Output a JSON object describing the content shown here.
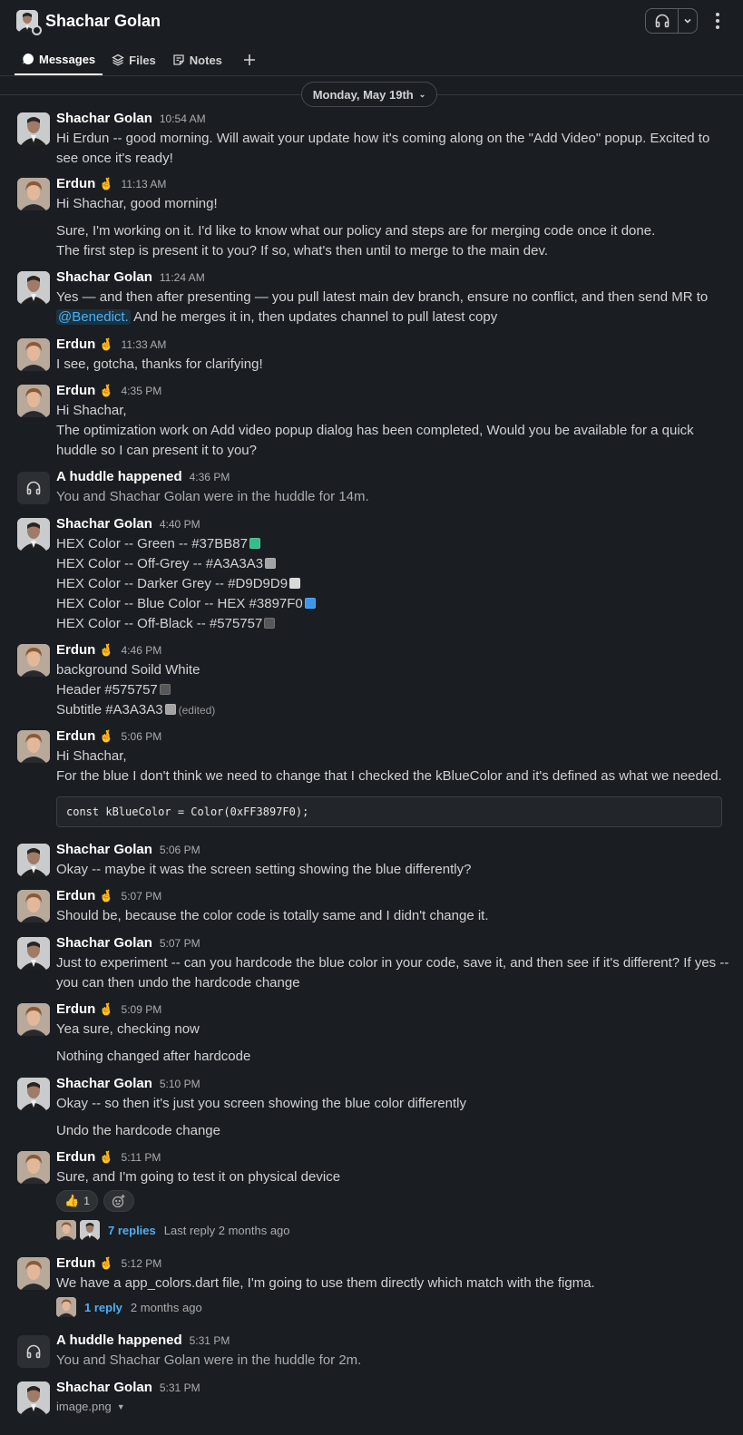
{
  "header": {
    "title": "Shachar Golan",
    "tabs": [
      {
        "label": "Messages",
        "icon": "message-bubble-icon",
        "active": true
      },
      {
        "label": "Files",
        "icon": "files-stack-icon",
        "active": false
      },
      {
        "label": "Notes",
        "icon": "notes-icon",
        "active": false
      }
    ]
  },
  "date_divider": "Monday, May 19th",
  "colors": {
    "background": "#1a1d21",
    "text": "#d1d2d3",
    "link": "#4faef2",
    "green": "#37BB87",
    "off_grey": "#A3A3A3",
    "darker_grey": "#D9D9D9",
    "blue": "#3897F0",
    "off_black": "#575757"
  },
  "messages": [
    {
      "author": "Shachar Golan",
      "time": "10:54 AM",
      "lines": [
        "Hi Erdun -- good morning. Will await your update how it's coming along on the \"Add Video\" popup. Excited to",
        "see once it's ready!"
      ]
    },
    {
      "author": "Erdun",
      "emoji": "🤞",
      "time": "11:13 AM",
      "lines": [
        "Hi Shachar, good morning!",
        "Sure, I'm working on it. I'd like to know what our policy and steps are for merging code once it done.",
        "The first step is present it to you?  If so, what's then until to merge to the main dev."
      ]
    },
    {
      "author": "Shachar Golan",
      "time": "11:24 AM",
      "lines": [
        "Yes — and then after presenting — you pull latest main dev branch, ensure no conflict, and then send MR to"
      ],
      "mention": "@Benedict.",
      "after_mention": " And he merges it in, then updates channel to pull latest copy"
    },
    {
      "author": "Erdun",
      "emoji": "🤞",
      "time": "11:33 AM",
      "lines": [
        "I see, gotcha, thanks for clarifying!"
      ]
    },
    {
      "author": "Erdun",
      "emoji": "🤞",
      "time": "4:35 PM",
      "lines": [
        "Hi Shachar,",
        "The optimization work on Add video popup dialog has been completed, Would you be available for a quick",
        "huddle so I can present it to you?"
      ]
    },
    {
      "author": "A huddle happened",
      "time": "4:36 PM",
      "lines": [
        "You and Shachar Golan were in the huddle for 14m."
      ]
    },
    {
      "author": "Shachar Golan",
      "time": "4:40 PM",
      "lines": [
        "HEX Color -- Green -- #37BB87",
        "HEX Color -- Off-Grey -- #A3A3A3",
        "HEX Color -- Darker Grey -- #D9D9D9",
        "HEX Color -- Blue Color -- HEX #3897F0",
        "HEX Color -- Off-Black -- #575757"
      ]
    },
    {
      "author": "Erdun",
      "emoji": "🤞",
      "time": "4:46 PM",
      "lines": [
        "background Soild White",
        "Header #575757",
        "Subtitle #A3A3A3"
      ],
      "edited": "(edited)"
    },
    {
      "author": "Erdun",
      "emoji": "🤞",
      "time": "5:06 PM",
      "lines": [
        "Hi Shachar,",
        "For the blue I don't think we need to change that I checked the kBlueColor and it's defined as what we needed."
      ],
      "code": "const kBlueColor = Color(0xFF3897F0);"
    },
    {
      "author": "Shachar Golan",
      "time": "5:06 PM",
      "lines": [
        "Okay -- maybe it was the screen setting showing the blue differently?"
      ]
    },
    {
      "author": "Erdun",
      "emoji": "🤞",
      "time": "5:07 PM",
      "lines": [
        "Should be, because the color code is totally same and I didn't change it."
      ]
    },
    {
      "author": "Shachar Golan",
      "time": "5:07 PM",
      "lines": [
        "Just to experiment -- can you hardcode the blue color in your code, save it, and then see if it's different? If yes --",
        "you can then undo the hardcode change"
      ]
    },
    {
      "author": "Erdun",
      "emoji": "🤞",
      "time": "5:09 PM",
      "lines": [
        "Yea sure, checking now",
        "Nothing changed after hardcode"
      ]
    },
    {
      "author": "Shachar Golan",
      "time": "5:10 PM",
      "lines": [
        "Okay -- so then it's just you screen showing the blue color differently",
        "Undo the hardcode change"
      ]
    },
    {
      "author": "Erdun",
      "emoji": "🤞",
      "time": "5:11 PM",
      "lines": [
        "Sure, and I'm going to test it on physical device"
      ],
      "reaction": {
        "emoji": "👍",
        "count": "1"
      },
      "thread": {
        "replies": "7 replies",
        "last": "Last reply 2 months ago"
      }
    },
    {
      "author": "Erdun",
      "emoji": "🤞",
      "time": "5:12 PM",
      "lines": [
        "We have a app_colors.dart file, I'm going to use them directly which match with the figma."
      ],
      "thread": {
        "replies": "1 reply",
        "last": "2 months ago"
      }
    },
    {
      "author": "A huddle happened",
      "time": "5:31 PM",
      "lines": [
        "You and Shachar Golan were in the huddle for 2m."
      ]
    },
    {
      "author": "Shachar Golan",
      "time": "5:31 PM",
      "file": "image.png"
    }
  ]
}
